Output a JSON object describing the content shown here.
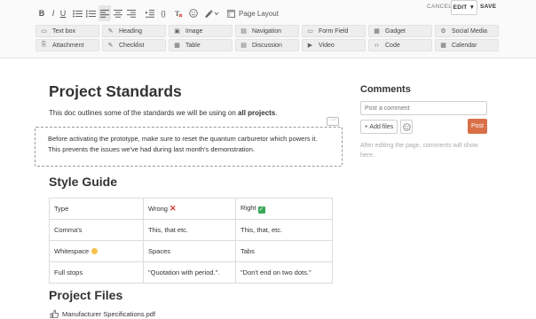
{
  "toolbar": {
    "format": [
      {
        "name": "bold-button",
        "label": "B"
      },
      {
        "name": "italic-button",
        "label": "I"
      },
      {
        "name": "underline-button",
        "label": "U"
      }
    ],
    "page_layout_label": "Page Layout",
    "cancel_label": "CANCEL",
    "edit_label": "EDIT ▼",
    "save_label": "SAVE",
    "blocks_row1": [
      {
        "label": "Text box",
        "icon": "text-box-icon",
        "glyph": "▭"
      },
      {
        "label": "Heading",
        "icon": "heading-icon",
        "glyph": "✎"
      },
      {
        "label": "Image",
        "icon": "image-icon",
        "glyph": "▣"
      },
      {
        "label": "Navigation",
        "icon": "navigation-icon",
        "glyph": "▤"
      },
      {
        "label": "Form Field",
        "icon": "form-field-icon",
        "glyph": "▭"
      },
      {
        "label": "Gadget",
        "icon": "gadget-icon",
        "glyph": "▦"
      },
      {
        "label": "Social Media",
        "icon": "social-media-icon",
        "glyph": "⚙"
      }
    ],
    "blocks_row2": [
      {
        "label": "Attachment",
        "icon": "attachment-icon",
        "glyph": "⎘"
      },
      {
        "label": "Checklist",
        "icon": "checklist-icon",
        "glyph": "✎"
      },
      {
        "label": "Table",
        "icon": "table-icon",
        "glyph": "▦"
      },
      {
        "label": "Discussion",
        "icon": "discussion-icon",
        "glyph": "▤"
      },
      {
        "label": "Video",
        "icon": "video-icon",
        "glyph": "▶"
      },
      {
        "label": "Code",
        "icon": "code-icon",
        "glyph": "‹›"
      },
      {
        "label": "Calendar",
        "icon": "calendar-icon",
        "glyph": "▦"
      }
    ]
  },
  "doc": {
    "title": "Project Standards",
    "intro_prefix": "This doc outlines some of the standards we will be using on ",
    "intro_bold": "all projects",
    "intro_suffix": ".",
    "callout_line1": "Before activating the prototype, make sure to reset the quantum carburetor which powers it.",
    "callout_line2": "This prevents the issues we've had during last month's demonstration.",
    "callout_menu": "···",
    "style_guide_heading": "Style Guide",
    "table": {
      "rows": [
        [
          "Type",
          "Wrong",
          "Right"
        ],
        [
          "Comma's",
          "This, that etc.",
          "This, that, etc."
        ],
        [
          "Whitespace",
          "Spaces",
          "Tabs"
        ],
        [
          "Full stops",
          "\"Quotation with period.\".",
          "\"Don't end on two dots.\""
        ]
      ]
    },
    "project_files_heading": "Project Files",
    "file_name": "Manufacturer Specifications.pdf"
  },
  "comments": {
    "title": "Comments",
    "placeholder": "Post a comment",
    "add_files_label": "+ Add files",
    "post_label": "Post",
    "note": "After editing the page, comments will show here."
  },
  "colors": {
    "accent": "#d97048",
    "wrong": "#d0392b",
    "right": "#3aa757"
  }
}
